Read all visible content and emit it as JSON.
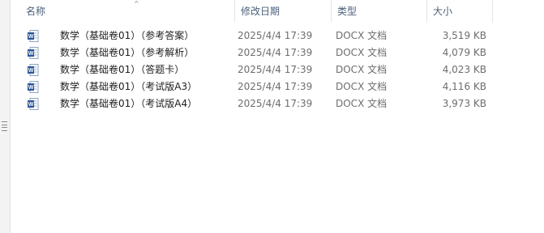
{
  "columns": {
    "name": "名称",
    "date": "修改日期",
    "type": "类型",
    "size": "大小"
  },
  "icons": {
    "file": "word-document-icon",
    "sort": "sort-ascending-icon"
  },
  "colors": {
    "header_text": "#4c607a",
    "word_blue": "#2a5699"
  },
  "files": [
    {
      "name": "数学（基础卷01）（参考答案）",
      "date": "2025/4/4 17:39",
      "type": "DOCX 文档",
      "size": "3,519 KB"
    },
    {
      "name": "数学（基础卷01）（参考解析）",
      "date": "2025/4/4 17:39",
      "type": "DOCX 文档",
      "size": "4,079 KB"
    },
    {
      "name": "数学（基础卷01）（答题卡）",
      "date": "2025/4/4 17:39",
      "type": "DOCX 文档",
      "size": "4,023 KB"
    },
    {
      "name": "数学（基础卷01）（考试版A3）",
      "date": "2025/4/4 17:39",
      "type": "DOCX 文档",
      "size": "4,116 KB"
    },
    {
      "name": "数学（基础卷01）（考试版A4）",
      "date": "2025/4/4 17:39",
      "type": "DOCX 文档",
      "size": "3,973 KB"
    }
  ]
}
